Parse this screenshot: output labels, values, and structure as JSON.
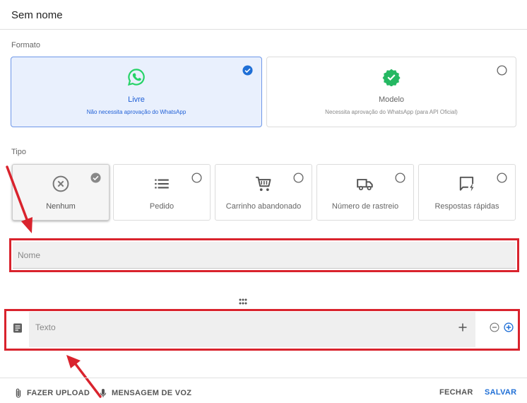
{
  "header": {
    "title": "Sem nome"
  },
  "formato": {
    "label": "Formato",
    "options": [
      {
        "name": "Livre",
        "description": "Não necessita aprovação do WhatsApp",
        "icon": "whatsapp-icon",
        "selected": true
      },
      {
        "name": "Modelo",
        "description": "Necessita aprovação do WhatsApp (para API Oficial)",
        "icon": "verified-badge-icon",
        "selected": false
      }
    ]
  },
  "tipo": {
    "label": "Tipo",
    "options": [
      {
        "name": "Nenhum",
        "icon": "close-circle-icon",
        "selected": true
      },
      {
        "name": "Pedido",
        "icon": "list-icon",
        "selected": false
      },
      {
        "name": "Carrinho abandonado",
        "icon": "cart-icon",
        "selected": false
      },
      {
        "name": "Número de rastreio",
        "icon": "truck-icon",
        "selected": false
      },
      {
        "name": "Respostas rápidas",
        "icon": "quick-reply-icon",
        "selected": false
      }
    ]
  },
  "form": {
    "nome_placeholder": "Nome",
    "texto_placeholder": "Texto"
  },
  "footer": {
    "upload_label": "FAZER UPLOAD",
    "voice_label": "MENSAGEM DE VOZ",
    "close_label": "FECHAR",
    "save_label": "SALVAR"
  },
  "colors": {
    "accent": "#1f6fd6",
    "selected_bg": "#e9f0fd",
    "whatsapp_green": "#25d366",
    "highlight_red": "#d9232d"
  }
}
